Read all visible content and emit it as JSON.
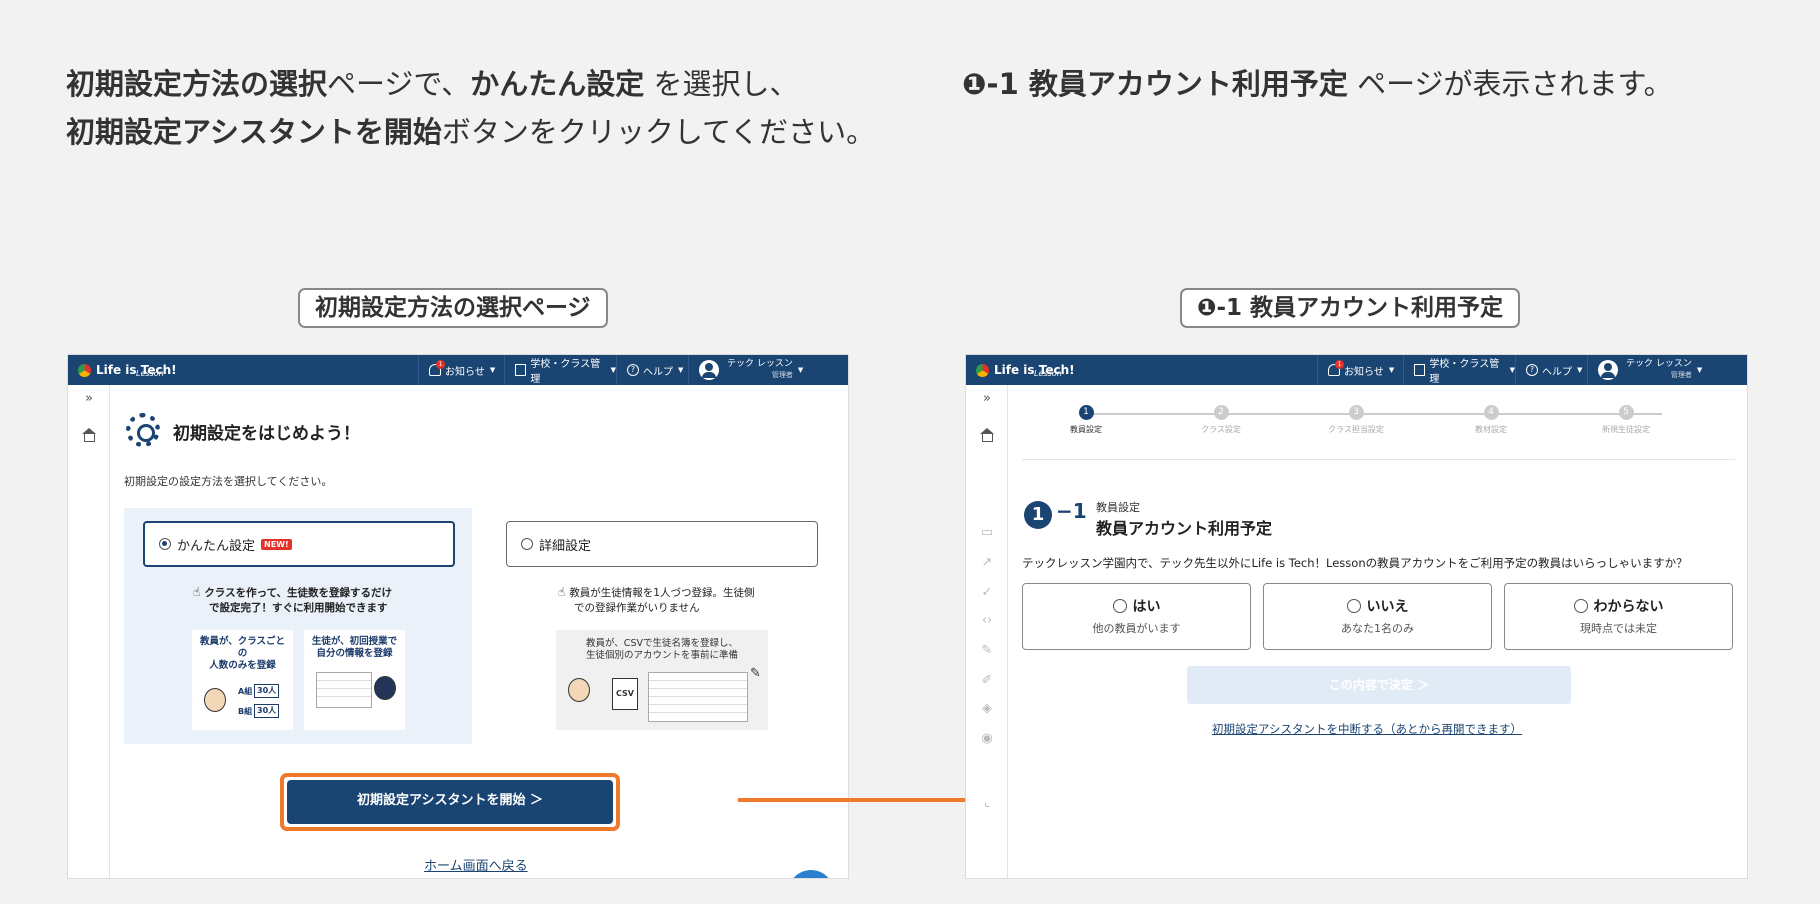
{
  "instructions": {
    "left": {
      "b1": "初期設定方法の選択",
      "t1": "ページで、",
      "b2": "かんたん設定",
      "t2": " を選択し、",
      "b3": "初期設定アシスタントを開始",
      "t3": "ボタンをクリックしてください。"
    },
    "right": {
      "b1": "❶-1 教員アカウント利用予定",
      "t1": " ページが表示されます。"
    }
  },
  "captions": {
    "left": "初期設定方法の選択ページ",
    "right": "❶-1 教員アカウント利用予定"
  },
  "app": {
    "logo": "Life is Tech!",
    "logo_sub": "Lesson",
    "nav": {
      "notifications": "お知らせ",
      "notification_count": "1",
      "school": "学校・クラス管理",
      "help": "ヘルプ",
      "user_name": "テック レッスン",
      "user_role": "管理者"
    }
  },
  "left_screen": {
    "title": "初期設定をはじめよう！",
    "subtitle": "初期設定の設定方法を選択してください。",
    "easy": {
      "label": "かんたん設定",
      "badge": "NEW!",
      "desc_line1": "クラスを作って、生徒数を登録するだけ",
      "desc_line2": "で設定完了！すぐに利用開始できます",
      "card1_l1": "教員が、クラスごと",
      "card1_l2": "の",
      "card1_l3": "人数のみを登録",
      "card1_a": "A組",
      "card1_a_num": "30人",
      "card1_b": "B組",
      "card1_b_num": "30人",
      "card2_l1": "生徒が、初回授業で",
      "card2_l2": "自分の情報を登録"
    },
    "detail": {
      "label": "詳細設定",
      "desc_line1": "教員が生徒情報を1人づつ登録。生徒側",
      "desc_line2": "での登録作業がいりません",
      "card_l1": "教員が、CSVで生徒名簿を登録し、",
      "card_l2": "生徒個別のアカウントを事前に準備",
      "csv": "CSV"
    },
    "start_button": "初期設定アシスタントを開始 ＞",
    "home_link": "ホーム画面へ戻る"
  },
  "right_screen": {
    "steps": [
      {
        "num": "1",
        "label": "教員設定"
      },
      {
        "num": "2",
        "label": "クラス設定"
      },
      {
        "num": "3",
        "label": "クラス担当設定"
      },
      {
        "num": "4",
        "label": "教材設定"
      },
      {
        "num": "5",
        "label": "新規生徒設定"
      }
    ],
    "heading_num": "1",
    "heading_dash": "−1",
    "heading_small": "教員設定",
    "heading_title": "教員アカウント利用予定",
    "question": "テックレッスン学園内で、テック先生以外にLife is Tech！Lessonの教員アカウントをご利用予定の教員はいらっしゃいますか？",
    "choices": [
      {
        "title": "はい",
        "sub": "他の教員がいます"
      },
      {
        "title": "いいえ",
        "sub": "あなた1名のみ"
      },
      {
        "title": "わからない",
        "sub": "現時点では未定"
      }
    ],
    "decide_button": "この内容で決定 ＞",
    "abort_link": "初期設定アシスタントを中断する（あとから再開できます）"
  },
  "colors": {
    "brand": "#1a4472",
    "highlight": "#f07a2c",
    "badge": "#e4322b"
  }
}
